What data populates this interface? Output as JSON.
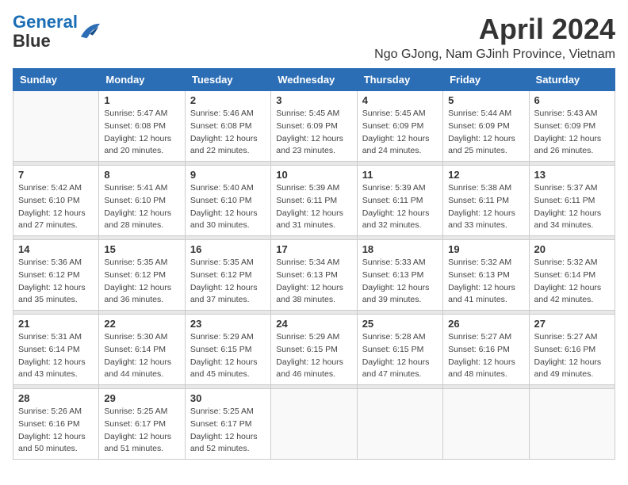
{
  "logo": {
    "line1": "General",
    "line2": "Blue"
  },
  "title": "April 2024",
  "subtitle": "Ngo GJong, Nam GJinh Province, Vietnam",
  "weekdays": [
    "Sunday",
    "Monday",
    "Tuesday",
    "Wednesday",
    "Thursday",
    "Friday",
    "Saturday"
  ],
  "weeks": [
    [
      {
        "day": null
      },
      {
        "day": "1",
        "sunrise": "5:47 AM",
        "sunset": "6:08 PM",
        "daylight": "12 hours and 20 minutes."
      },
      {
        "day": "2",
        "sunrise": "5:46 AM",
        "sunset": "6:08 PM",
        "daylight": "12 hours and 22 minutes."
      },
      {
        "day": "3",
        "sunrise": "5:45 AM",
        "sunset": "6:09 PM",
        "daylight": "12 hours and 23 minutes."
      },
      {
        "day": "4",
        "sunrise": "5:45 AM",
        "sunset": "6:09 PM",
        "daylight": "12 hours and 24 minutes."
      },
      {
        "day": "5",
        "sunrise": "5:44 AM",
        "sunset": "6:09 PM",
        "daylight": "12 hours and 25 minutes."
      },
      {
        "day": "6",
        "sunrise": "5:43 AM",
        "sunset": "6:09 PM",
        "daylight": "12 hours and 26 minutes."
      }
    ],
    [
      {
        "day": "7",
        "sunrise": "5:42 AM",
        "sunset": "6:10 PM",
        "daylight": "12 hours and 27 minutes."
      },
      {
        "day": "8",
        "sunrise": "5:41 AM",
        "sunset": "6:10 PM",
        "daylight": "12 hours and 28 minutes."
      },
      {
        "day": "9",
        "sunrise": "5:40 AM",
        "sunset": "6:10 PM",
        "daylight": "12 hours and 30 minutes."
      },
      {
        "day": "10",
        "sunrise": "5:39 AM",
        "sunset": "6:11 PM",
        "daylight": "12 hours and 31 minutes."
      },
      {
        "day": "11",
        "sunrise": "5:39 AM",
        "sunset": "6:11 PM",
        "daylight": "12 hours and 32 minutes."
      },
      {
        "day": "12",
        "sunrise": "5:38 AM",
        "sunset": "6:11 PM",
        "daylight": "12 hours and 33 minutes."
      },
      {
        "day": "13",
        "sunrise": "5:37 AM",
        "sunset": "6:11 PM",
        "daylight": "12 hours and 34 minutes."
      }
    ],
    [
      {
        "day": "14",
        "sunrise": "5:36 AM",
        "sunset": "6:12 PM",
        "daylight": "12 hours and 35 minutes."
      },
      {
        "day": "15",
        "sunrise": "5:35 AM",
        "sunset": "6:12 PM",
        "daylight": "12 hours and 36 minutes."
      },
      {
        "day": "16",
        "sunrise": "5:35 AM",
        "sunset": "6:12 PM",
        "daylight": "12 hours and 37 minutes."
      },
      {
        "day": "17",
        "sunrise": "5:34 AM",
        "sunset": "6:13 PM",
        "daylight": "12 hours and 38 minutes."
      },
      {
        "day": "18",
        "sunrise": "5:33 AM",
        "sunset": "6:13 PM",
        "daylight": "12 hours and 39 minutes."
      },
      {
        "day": "19",
        "sunrise": "5:32 AM",
        "sunset": "6:13 PM",
        "daylight": "12 hours and 41 minutes."
      },
      {
        "day": "20",
        "sunrise": "5:32 AM",
        "sunset": "6:14 PM",
        "daylight": "12 hours and 42 minutes."
      }
    ],
    [
      {
        "day": "21",
        "sunrise": "5:31 AM",
        "sunset": "6:14 PM",
        "daylight": "12 hours and 43 minutes."
      },
      {
        "day": "22",
        "sunrise": "5:30 AM",
        "sunset": "6:14 PM",
        "daylight": "12 hours and 44 minutes."
      },
      {
        "day": "23",
        "sunrise": "5:29 AM",
        "sunset": "6:15 PM",
        "daylight": "12 hours and 45 minutes."
      },
      {
        "day": "24",
        "sunrise": "5:29 AM",
        "sunset": "6:15 PM",
        "daylight": "12 hours and 46 minutes."
      },
      {
        "day": "25",
        "sunrise": "5:28 AM",
        "sunset": "6:15 PM",
        "daylight": "12 hours and 47 minutes."
      },
      {
        "day": "26",
        "sunrise": "5:27 AM",
        "sunset": "6:16 PM",
        "daylight": "12 hours and 48 minutes."
      },
      {
        "day": "27",
        "sunrise": "5:27 AM",
        "sunset": "6:16 PM",
        "daylight": "12 hours and 49 minutes."
      }
    ],
    [
      {
        "day": "28",
        "sunrise": "5:26 AM",
        "sunset": "6:16 PM",
        "daylight": "12 hours and 50 minutes."
      },
      {
        "day": "29",
        "sunrise": "5:25 AM",
        "sunset": "6:17 PM",
        "daylight": "12 hours and 51 minutes."
      },
      {
        "day": "30",
        "sunrise": "5:25 AM",
        "sunset": "6:17 PM",
        "daylight": "12 hours and 52 minutes."
      },
      {
        "day": null
      },
      {
        "day": null
      },
      {
        "day": null
      },
      {
        "day": null
      }
    ]
  ],
  "labels": {
    "sunrise": "Sunrise:",
    "sunset": "Sunset:",
    "daylight": "Daylight:"
  }
}
